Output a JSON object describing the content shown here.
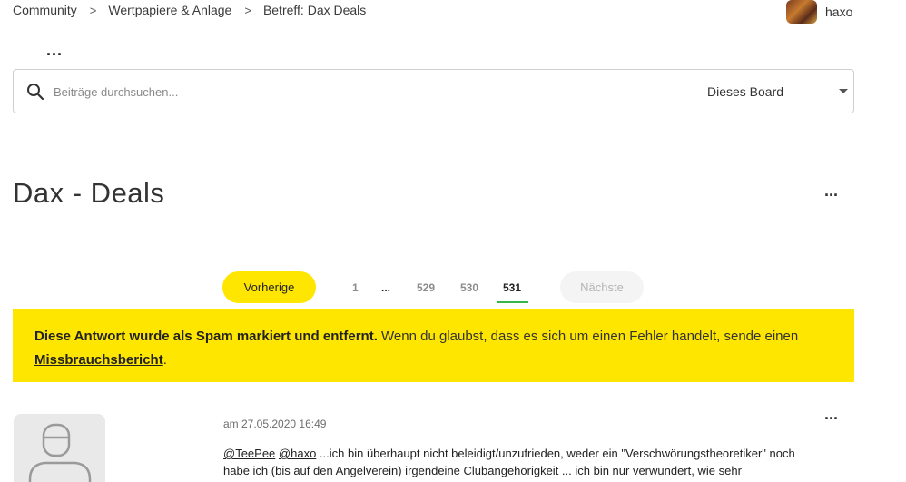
{
  "breadcrumb": {
    "items": [
      "Community",
      "Wertpapiere & Anlage",
      "Betreff: Dax Deals"
    ],
    "separator": ">"
  },
  "user": {
    "name": "haxo"
  },
  "top_menu": {
    "label": "..."
  },
  "search": {
    "placeholder": "Beiträge durchsuchen...",
    "scope": "Dieses Board"
  },
  "page": {
    "title": "Dax - Deals",
    "menu": "..."
  },
  "pagination": {
    "prev": "Vorherige",
    "next": "Nächste",
    "pages": [
      "1",
      "...",
      "529",
      "530",
      "531"
    ],
    "current": "531"
  },
  "spam_banner": {
    "bold": "Diese Antwort wurde als Spam markiert und entfernt.",
    "text": " Wenn du glaubst, dass es sich um einen Fehler handelt, sende einen ",
    "link": "Missbrauchsbericht",
    "end": "."
  },
  "post": {
    "date": "am 27.05.2020 16:49",
    "menu": "...",
    "mention1": "@TeePee",
    "mention2": "@haxo",
    "text": " ...ich bin überhaupt nicht beleidigt/unzufrieden, weder ein \"Verschwörungstheoretiker\" noch habe ich (bis auf den Angelverein) irgendeine Clubangehörigkeit ... ich bin nur verwundert, wie sehr"
  },
  "colors": {
    "accent": "#ffe600",
    "current_page_underline": "#39b54a"
  }
}
